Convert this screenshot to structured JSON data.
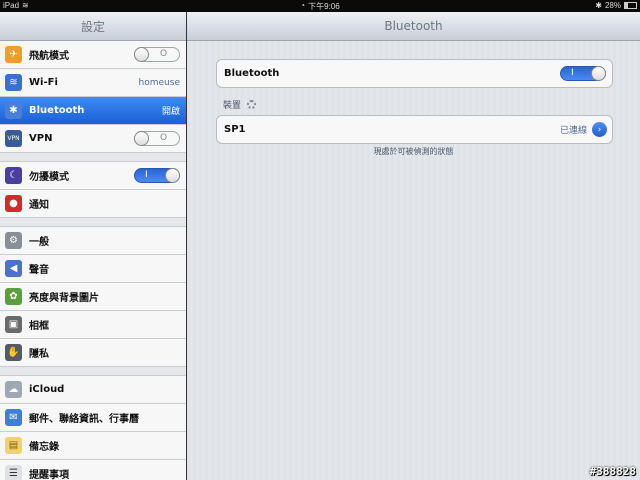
{
  "status_bar": {
    "device": "iPad",
    "time": "下午9:06",
    "battery": "28%",
    "battery_level": 0.28
  },
  "sidebar": {
    "title": "設定",
    "items": [
      {
        "label": "飛航模式",
        "icon": "airplane-icon",
        "icon_color": "#f29c2a",
        "control": "toggle-off",
        "toggle_text": "O"
      },
      {
        "label": "Wi-Fi",
        "icon": "wifi-icon",
        "icon_color": "#3c6fd4",
        "value": "homeuse"
      },
      {
        "label": "Bluetooth",
        "icon": "bluetooth-icon",
        "icon_color": "#4a7fd9",
        "value": "開啟",
        "selected": true
      },
      {
        "label": "VPN",
        "icon": "vpn-icon",
        "icon_color": "#3a5a9a",
        "control": "toggle-off",
        "toggle_text": "O"
      },
      {
        "label": "勿擾模式",
        "icon": "moon-icon",
        "icon_color": "#4a3f9c",
        "control": "toggle-on",
        "toggle_text": "I"
      },
      {
        "label": "通知",
        "icon": "notifications-icon",
        "icon_color": "#d12b2b"
      },
      {
        "label": "一般",
        "icon": "gear-icon",
        "icon_color": "#8a8f97"
      },
      {
        "label": "聲音",
        "icon": "speaker-icon",
        "icon_color": "#4b72c9"
      },
      {
        "label": "亮度與背景圖片",
        "icon": "flower-icon",
        "icon_color": "#5b9e3a"
      },
      {
        "label": "相框",
        "icon": "picture-frame-icon",
        "icon_color": "#6a6a6a"
      },
      {
        "label": "隱私",
        "icon": "hand-icon",
        "icon_color": "#555b66"
      },
      {
        "label": "iCloud",
        "icon": "cloud-icon",
        "icon_color": "#9ea7b5"
      },
      {
        "label": "郵件、聯絡資訊、行事曆",
        "icon": "mail-icon",
        "icon_color": "#3f7fd8"
      },
      {
        "label": "備忘錄",
        "icon": "notes-icon",
        "icon_color": "#f2d36b"
      },
      {
        "label": "提醒事項",
        "icon": "reminders-icon",
        "icon_color": "#dfe1e4"
      }
    ]
  },
  "main": {
    "title": "Bluetooth",
    "bluetooth_row": {
      "label": "Bluetooth",
      "toggle_text": "I",
      "state": "on"
    },
    "devices_section_label": "裝置",
    "device": {
      "name": "SP1",
      "status": "已連線"
    },
    "footer_note": "現處於可被偵測的狀態"
  },
  "watermark": "#388828",
  "colors": {
    "selected_row": "#1a5fd6",
    "toggle_on": "#2a63d4",
    "detail_text": "#4f6d9a"
  }
}
